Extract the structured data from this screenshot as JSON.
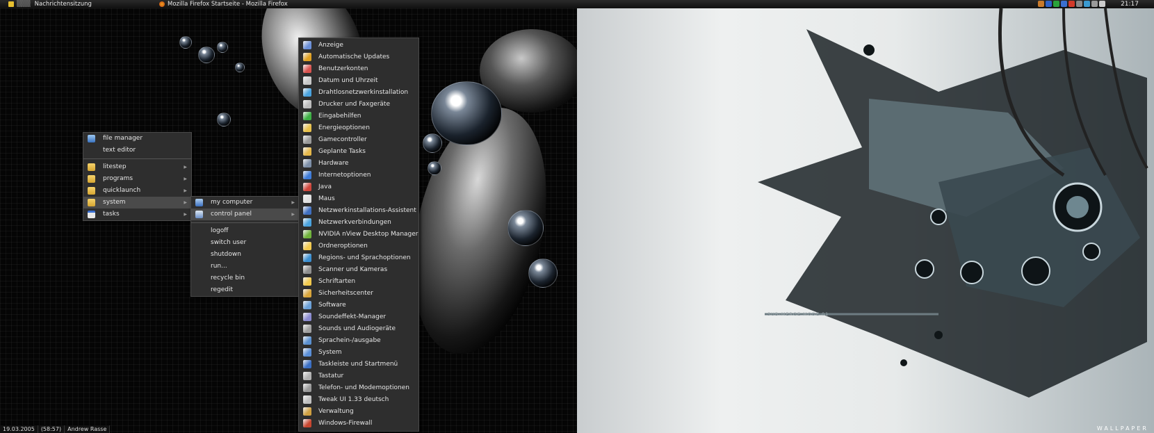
{
  "taskbar": {
    "tasks": [
      {
        "label": "Nachrichtensitzung",
        "icon": "messenger-icon"
      },
      {
        "label": "Mozilla Firefox Startseite - Mozilla Firefox",
        "icon": "firefox-icon"
      }
    ],
    "clock": "21:17"
  },
  "desktop_menu": {
    "items": [
      {
        "label": "file manager",
        "icon": "file-manager-icon"
      },
      {
        "label": "text editor"
      }
    ],
    "folders": [
      {
        "label": "litestep",
        "icon": "folder-icon"
      },
      {
        "label": "programs",
        "icon": "folder-icon"
      },
      {
        "label": "quicklaunch",
        "icon": "folder-icon"
      },
      {
        "label": "system",
        "icon": "folder-icon"
      },
      {
        "label": "tasks",
        "icon": "window-icon"
      }
    ]
  },
  "system_menu": {
    "items": [
      {
        "label": "my computer",
        "icon": "computer-icon"
      },
      {
        "label": "control panel",
        "icon": "control-panel-icon"
      }
    ],
    "actions": [
      "logoff",
      "switch user",
      "shutdown",
      "run...",
      "recycle bin",
      "regedit"
    ]
  },
  "control_panel_menu": {
    "items": [
      {
        "label": "Anzeige",
        "color": "#6a8fd8"
      },
      {
        "label": "Automatische Updates",
        "color": "#e0a020"
      },
      {
        "label": "Benutzerkonten",
        "color": "#d9534f"
      },
      {
        "label": "Datum und Uhrzeit",
        "color": "#c8c8c8"
      },
      {
        "label": "Drahtlosnetzwerkinstallation",
        "color": "#4aa3df"
      },
      {
        "label": "Drucker und Faxgeräte",
        "color": "#bcbcbc"
      },
      {
        "label": "Eingabehilfen",
        "color": "#3cb043"
      },
      {
        "label": "Energieoptionen",
        "color": "#e8c14a"
      },
      {
        "label": "Gamecontroller",
        "color": "#9a9a9a"
      },
      {
        "label": "Geplante Tasks",
        "color": "#e6b84a"
      },
      {
        "label": "Hardware",
        "color": "#7d8fa8"
      },
      {
        "label": "Internetoptionen",
        "color": "#3d7bd9"
      },
      {
        "label": "Java",
        "color": "#d0463b"
      },
      {
        "label": "Maus",
        "color": "#e0e0e0"
      },
      {
        "label": "Netzwerkinstallations-Assistent",
        "color": "#3f6fc0"
      },
      {
        "label": "Netzwerkverbindungen",
        "color": "#4aa3df"
      },
      {
        "label": "NVIDIA nView Desktop Manager",
        "color": "#6fb33a"
      },
      {
        "label": "Ordneroptionen",
        "color": "#f2c94c"
      },
      {
        "label": "Regions- und Sprachoptionen",
        "color": "#3b8fd1"
      },
      {
        "label": "Scanner und Kameras",
        "color": "#8f8f8f"
      },
      {
        "label": "Schriftarten",
        "color": "#f2c94c"
      },
      {
        "label": "Sicherheitscenter",
        "color": "#d9a53a"
      },
      {
        "label": "Software",
        "color": "#6aa0d8"
      },
      {
        "label": "Soundeffekt-Manager",
        "color": "#8a8ad0"
      },
      {
        "label": "Sounds und Audiogeräte",
        "color": "#a0a0a0"
      },
      {
        "label": "Sprachein-/ausgabe",
        "color": "#5a90d0"
      },
      {
        "label": "System",
        "color": "#5a8fd8"
      },
      {
        "label": "Taskleiste und Startmenü",
        "color": "#3a6fc5"
      },
      {
        "label": "Tastatur",
        "color": "#b0b0b0"
      },
      {
        "label": "Telefon- und Modemoptionen",
        "color": "#9a9a9a"
      },
      {
        "label": "Tweak UI 1.33 deutsch",
        "color": "#c0c0c0"
      },
      {
        "label": "Verwaltung",
        "color": "#d0a040"
      },
      {
        "label": "Windows-Firewall",
        "color": "#c8462f"
      }
    ]
  },
  "statusbar": {
    "date": "19.03.2005",
    "uptime": "(58:57)",
    "user": "Andrew Rasse"
  },
  "wallpaper": {
    "watermark": "WALLPAPER",
    "label": "SUB-MERGE MODE 01"
  }
}
